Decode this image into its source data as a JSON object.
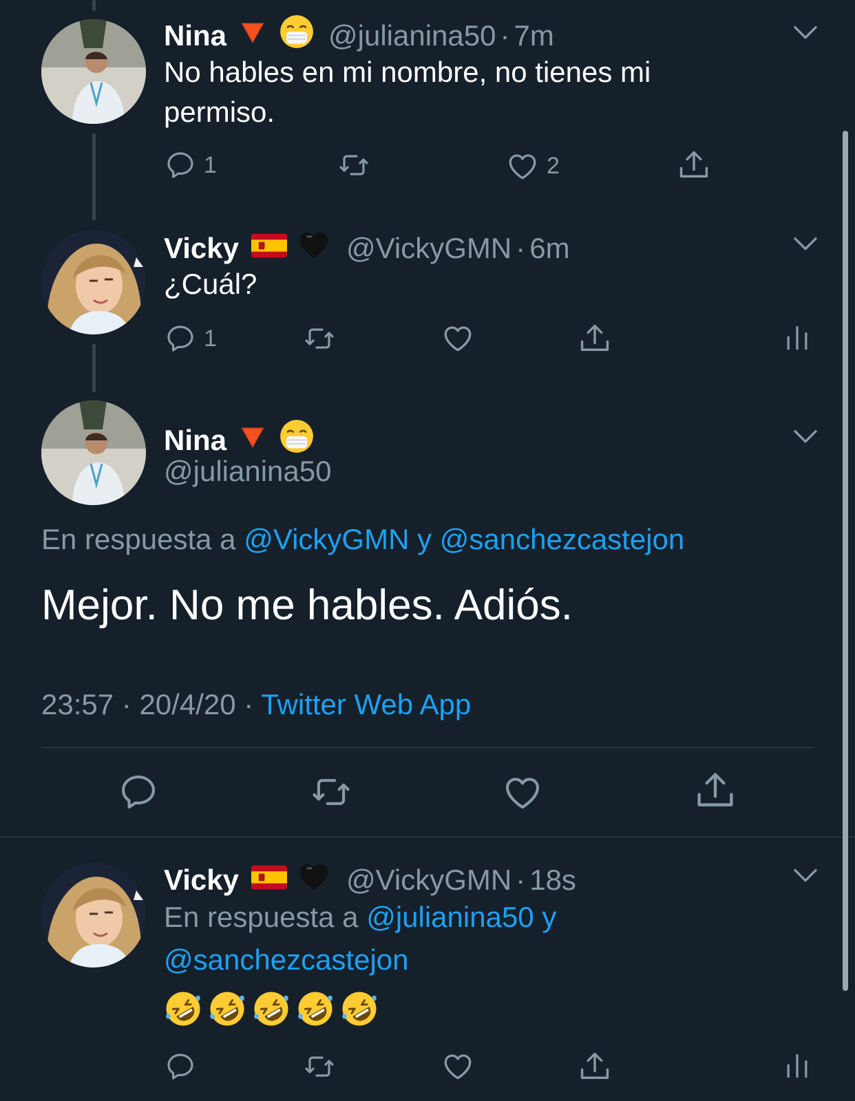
{
  "colors": {
    "background": "#15202b",
    "text": "#ffffff",
    "muted": "#8899a6",
    "link": "#1da1f2",
    "divider": "#38444d"
  },
  "tweets": [
    {
      "name": "Nina",
      "badges": [
        "red-triangle-icon",
        "mask-face-emoji-icon"
      ],
      "handle": "@julianina50",
      "sep": "·",
      "time": "7m",
      "text": "No hables en mi nombre, no tienes mi permiso.",
      "reply_count": "1",
      "like_count": "2"
    },
    {
      "name": "Vicky",
      "badges": [
        "spain-flag-icon",
        "black-heart-icon"
      ],
      "handle": "@VickyGMN",
      "sep": "·",
      "time": "6m",
      "text": "¿Cuál?",
      "reply_count": "1"
    }
  ],
  "focus": {
    "name": "Nina",
    "handle": "@julianina50",
    "reply_prefix": "En respuesta a",
    "reply_user1": "@VickyGMN",
    "reply_and": "y",
    "reply_user2": "@sanchezcastejon",
    "text": "Mejor. No me hables. Adiós.",
    "time": "23:57",
    "sep": "·",
    "date": "20/4/20",
    "source": "Twitter Web App"
  },
  "reply": {
    "name": "Vicky",
    "handle": "@VickyGMN",
    "sep": "·",
    "time": "18s",
    "reply_prefix": "En respuesta a",
    "reply_user1": "@julianina50",
    "reply_and": "y",
    "reply_user2": "@sanchezcastejon",
    "emojis": [
      "rofl-emoji-icon",
      "rofl-emoji-icon",
      "rofl-emoji-icon",
      "rofl-emoji-icon",
      "rofl-emoji-icon"
    ]
  }
}
